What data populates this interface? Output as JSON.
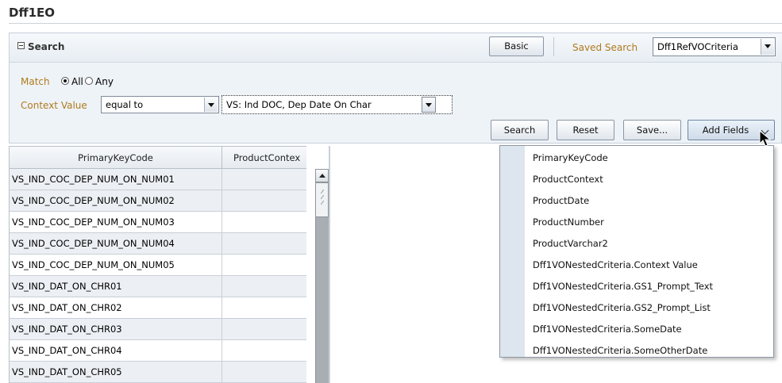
{
  "page": {
    "title": "Dff1EO"
  },
  "search_panel": {
    "title": "Search",
    "basic_button": "Basic",
    "saved_search_label": "Saved Search",
    "saved_search_value": "Dff1RefVOCriteria"
  },
  "match": {
    "label": "Match",
    "options": [
      "All",
      "Any"
    ],
    "selected": "All"
  },
  "context_value": {
    "label": "Context Value",
    "operator": "equal to",
    "value": "VS: Ind DOC, Dep Date On Char"
  },
  "actions": {
    "search": "Search",
    "reset": "Reset",
    "save": "Save...",
    "add_fields": "Add Fields"
  },
  "table": {
    "columns": [
      "PrimaryKeyCode",
      "ProductContex"
    ],
    "rows": [
      "VS_IND_COC_DEP_NUM_ON_NUM01",
      "VS_IND_COC_DEP_NUM_ON_NUM02",
      "VS_IND_COC_DEP_NUM_ON_NUM03",
      "VS_IND_COC_DEP_NUM_ON_NUM04",
      "VS_IND_COC_DEP_NUM_ON_NUM05",
      "VS_IND_DAT_ON_CHR01",
      "VS_IND_DAT_ON_CHR02",
      "VS_IND_DAT_ON_CHR03",
      "VS_IND_DAT_ON_CHR04",
      "VS_IND_DAT_ON_CHR05"
    ]
  },
  "add_fields_menu": {
    "items": [
      "PrimaryKeyCode",
      "ProductContext",
      "ProductDate",
      "ProductNumber",
      "ProductVarchar2",
      "Dff1VONestedCriteria.Context Value",
      "Dff1VONestedCriteria.GS1_Prompt_Text",
      "Dff1VONestedCriteria.GS2_Prompt_List",
      "Dff1VONestedCriteria.SomeDate",
      "Dff1VONestedCriteria.SomeOtherDate"
    ]
  },
  "icons": {
    "collapse": "collapse-minus-icon",
    "dropdown": "chevron-down-icon",
    "cursor": "mouse-pointer-icon"
  },
  "colors": {
    "label_orange": "#b07a1c",
    "panel_bg": "#eef3f8",
    "menu_gutter": "#dde5ee"
  }
}
